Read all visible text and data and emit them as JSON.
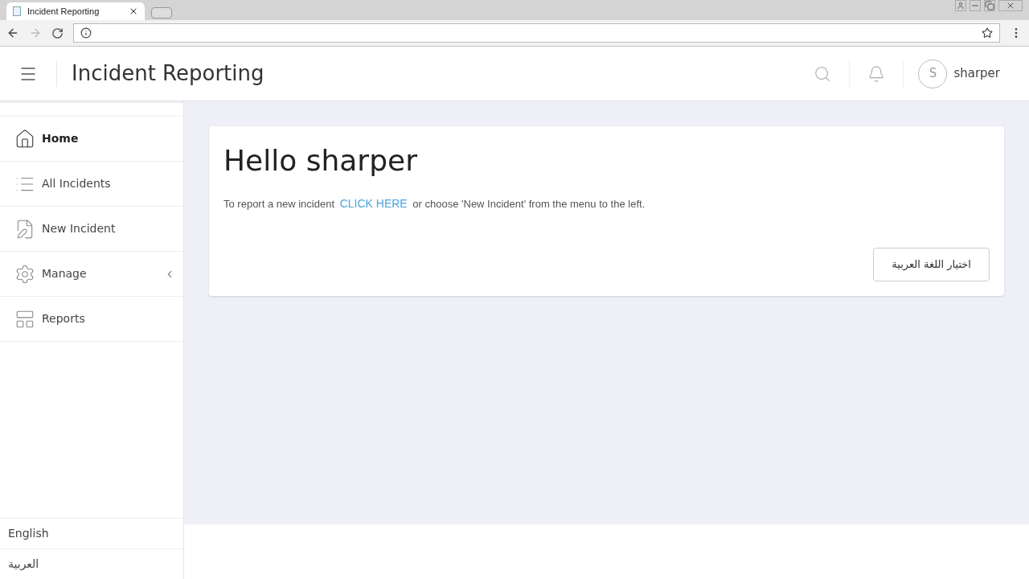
{
  "browser": {
    "tab_title": "Incident Reporting"
  },
  "header": {
    "title": "Incident Reporting",
    "avatar_initial": "S",
    "username": "sharper"
  },
  "sidebar": {
    "items": [
      {
        "kind": "home",
        "label": "Home",
        "selected": true
      },
      {
        "kind": "list",
        "label": "All Incidents",
        "selected": false
      },
      {
        "kind": "edit",
        "label": "New Incident",
        "selected": false
      },
      {
        "kind": "gear",
        "label": "Manage",
        "selected": false,
        "expandable": true
      },
      {
        "kind": "reports",
        "label": "Reports",
        "selected": false
      }
    ],
    "languages": [
      "English",
      "العربية"
    ]
  },
  "card": {
    "heading": "Hello sharper",
    "text_before": "To report a new incident",
    "link": "CLICK HERE",
    "text_after": "or choose 'New Incident' from the menu to the left.",
    "button": "اختيار اللغة العربية"
  }
}
